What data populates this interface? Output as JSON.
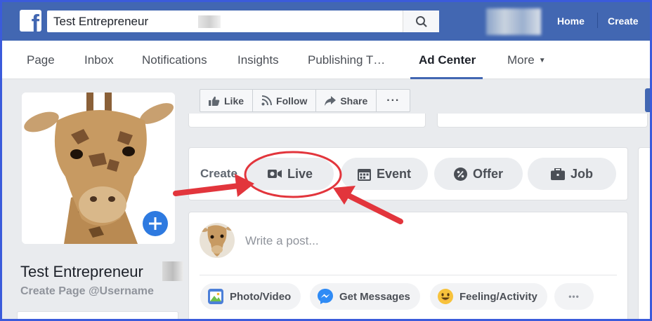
{
  "topbar": {
    "logo_letter": "f",
    "search_value": "Test Entrepreneur",
    "links": [
      "Home",
      "Create"
    ]
  },
  "pagenav": {
    "items": [
      "Page",
      "Inbox",
      "Notifications",
      "Insights",
      "Publishing T…",
      "Ad Center",
      "More"
    ],
    "active": "Ad Center"
  },
  "profile": {
    "name": "Test Entrepreneur",
    "username_link": "Create Page @Username"
  },
  "actions": {
    "like": "Like",
    "follow": "Follow",
    "share": "Share",
    "more": "···"
  },
  "create": {
    "label": "Create",
    "buttons": [
      "Live",
      "Event",
      "Offer",
      "Job"
    ]
  },
  "post": {
    "placeholder": "Write a post...",
    "chips": [
      "Photo/Video",
      "Get Messages",
      "Feeling/Activity"
    ],
    "more": "•••"
  },
  "colors": {
    "facebook_blue": "#4267b2",
    "annotation_red": "#e2353c",
    "frame_blue": "#3b5bdb"
  },
  "icons": [
    "facebook-logo-icon",
    "search-icon",
    "add-photo-plus-icon",
    "thumbs-up-icon",
    "rss-follow-icon",
    "share-arrow-icon",
    "video-camera-icon",
    "calendar-icon",
    "percent-tag-icon",
    "briefcase-icon",
    "photo-video-icon",
    "messenger-icon",
    "smiley-icon"
  ]
}
